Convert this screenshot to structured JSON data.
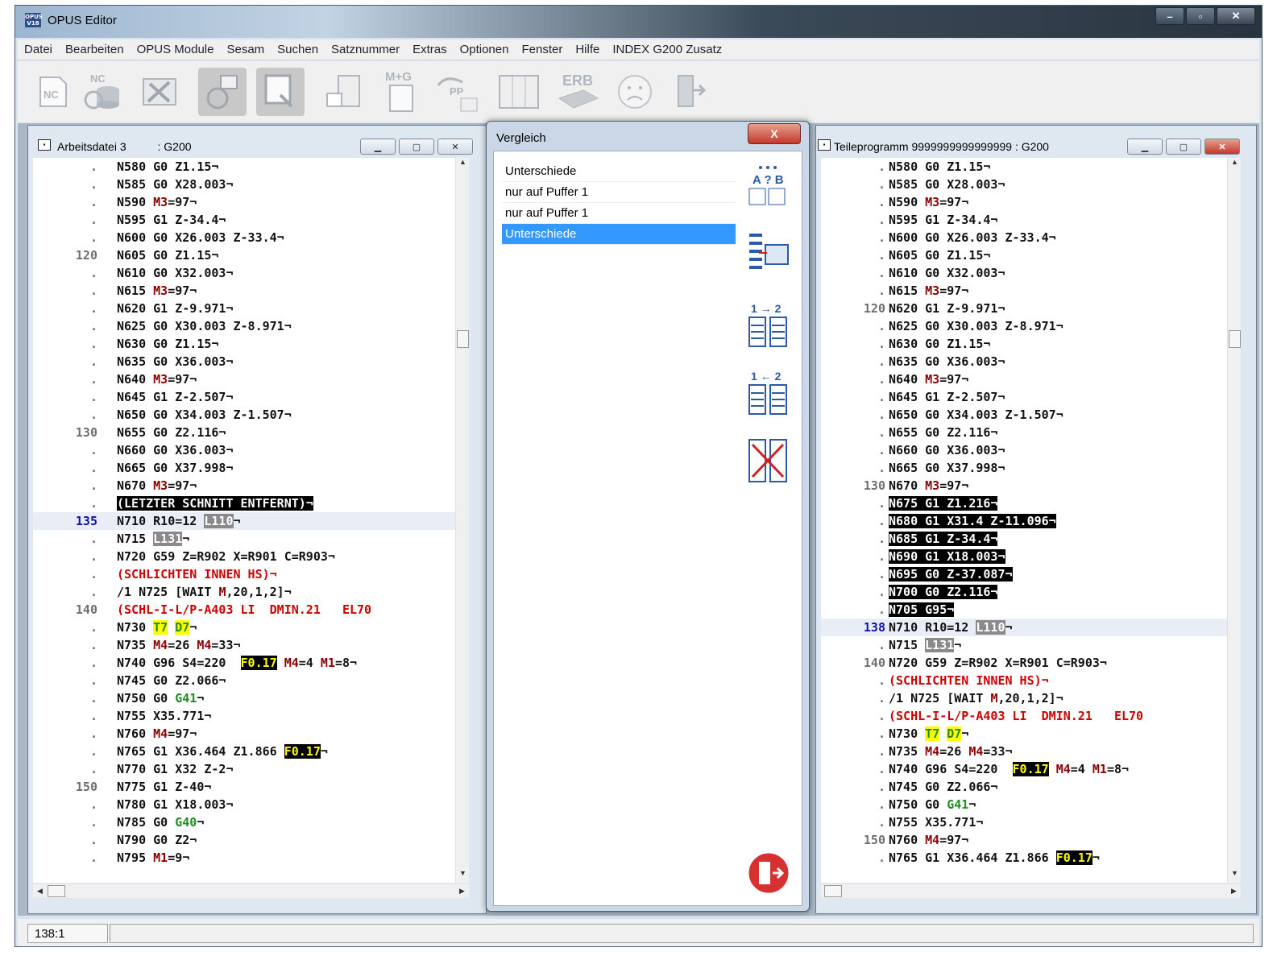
{
  "app": {
    "title": "OPUS Editor",
    "icon_label": "OPUS V18"
  },
  "window_controls": {
    "minimize": "–",
    "maximize": "▫",
    "close": "✕"
  },
  "menu": [
    "Datei",
    "Bearbeiten",
    "OPUS Module",
    "Sesam",
    "Suchen",
    "Satznummer",
    "Extras",
    "Optionen",
    "Fenster",
    "Hilfe",
    "INDEX G200 Zusatz"
  ],
  "toolbar": {
    "nc_label": "NC",
    "nc_db_label": "NC",
    "mg_label": "M+G",
    "erb_label": "ERB",
    "pp_label": "PP"
  },
  "left_window": {
    "title": "Arbeitsdatei 3          : G200",
    "lines": [
      {
        "n": ".",
        "t": "N580 G0 Z1.15¬"
      },
      {
        "n": ".",
        "t": "N585 G0 X28.003¬"
      },
      {
        "n": ".",
        "t": "N590 M3=97¬"
      },
      {
        "n": ".",
        "t": "N595 G1 Z-34.4¬"
      },
      {
        "n": ".",
        "t": "N600 G0 X26.003 Z-33.4¬"
      },
      {
        "n": "120",
        "t": "N605 G0 Z1.15¬"
      },
      {
        "n": ".",
        "t": "N610 G0 X32.003¬"
      },
      {
        "n": ".",
        "t": "N615 M3=97¬"
      },
      {
        "n": ".",
        "t": "N620 G1 Z-9.971¬"
      },
      {
        "n": ".",
        "t": "N625 G0 X30.003 Z-8.971¬"
      },
      {
        "n": ".",
        "t": "N630 G0 Z1.15¬"
      },
      {
        "n": ".",
        "t": "N635 G0 X36.003¬"
      },
      {
        "n": ".",
        "t": "N640 M3=97¬"
      },
      {
        "n": ".",
        "t": "N645 G1 Z-2.507¬"
      },
      {
        "n": ".",
        "t": "N650 G0 X34.003 Z-1.507¬"
      },
      {
        "n": "130",
        "t": "N655 G0 Z2.116¬"
      },
      {
        "n": ".",
        "t": "N660 G0 X36.003¬"
      },
      {
        "n": ".",
        "t": "N665 G0 X37.998¬"
      },
      {
        "n": ".",
        "t": "N670 M3=97¬"
      },
      {
        "n": ".",
        "t": "(LETZTER SCHNITT ENTFERNT)¬"
      },
      {
        "n": "135",
        "t": "N710 R10=12 L110¬"
      },
      {
        "n": ".",
        "t": "N715 L131¬"
      },
      {
        "n": ".",
        "t": "N720 G59 Z=R902 X=R901 C=R903¬"
      },
      {
        "n": ".",
        "t": "(SCHLICHTEN INNEN HS)¬"
      },
      {
        "n": ".",
        "t": "/1 N725 [WAIT M,20,1,2]¬"
      },
      {
        "n": "140",
        "t": "(SCHL-I-L/P-A403 LI  DMIN.21   EL70"
      },
      {
        "n": ".",
        "t": "N730 T7 D7¬"
      },
      {
        "n": ".",
        "t": "N735 M4=26 M4=33¬"
      },
      {
        "n": ".",
        "t": "N740 G96 S4=220  F0.17 M4=4 M1=8¬"
      },
      {
        "n": ".",
        "t": "N745 G0 Z2.066¬"
      },
      {
        "n": ".",
        "t": "N750 G0 G41¬"
      },
      {
        "n": ".",
        "t": "N755 X35.771¬"
      },
      {
        "n": ".",
        "t": "N760 M4=97¬"
      },
      {
        "n": ".",
        "t": "N765 G1 X36.464 Z1.866 F0.17¬"
      },
      {
        "n": ".",
        "t": "N770 G1 X32 Z-2¬"
      },
      {
        "n": "150",
        "t": "N775 G1 Z-40¬"
      },
      {
        "n": ".",
        "t": "N780 G1 X18.003¬"
      },
      {
        "n": ".",
        "t": "N785 G0 G40¬"
      },
      {
        "n": ".",
        "t": "N790 G0 Z2¬"
      },
      {
        "n": ".",
        "t": "N795 M1=9¬"
      }
    ]
  },
  "right_window": {
    "title": "Teileprogramm 9999999999999999 : G200",
    "lines": [
      {
        "n": ".",
        "t": "N580 G0 Z1.15¬"
      },
      {
        "n": ".",
        "t": "N585 G0 X28.003¬"
      },
      {
        "n": ".",
        "t": "N590 M3=97¬"
      },
      {
        "n": ".",
        "t": "N595 G1 Z-34.4¬"
      },
      {
        "n": ".",
        "t": "N600 G0 X26.003 Z-33.4¬"
      },
      {
        "n": ".",
        "t": "N605 G0 Z1.15¬"
      },
      {
        "n": ".",
        "t": "N610 G0 X32.003¬"
      },
      {
        "n": ".",
        "t": "N615 M3=97¬"
      },
      {
        "n": "120",
        "t": "N620 G1 Z-9.971¬"
      },
      {
        "n": ".",
        "t": "N625 G0 X30.003 Z-8.971¬"
      },
      {
        "n": ".",
        "t": "N630 G0 Z1.15¬"
      },
      {
        "n": ".",
        "t": "N635 G0 X36.003¬"
      },
      {
        "n": ".",
        "t": "N640 M3=97¬"
      },
      {
        "n": ".",
        "t": "N645 G1 Z-2.507¬"
      },
      {
        "n": ".",
        "t": "N650 G0 X34.003 Z-1.507¬"
      },
      {
        "n": ".",
        "t": "N655 G0 Z2.116¬"
      },
      {
        "n": ".",
        "t": "N660 G0 X36.003¬"
      },
      {
        "n": ".",
        "t": "N665 G0 X37.998¬"
      },
      {
        "n": "130",
        "t": "N670 M3=97¬"
      },
      {
        "n": ".",
        "t": "N675 G1 Z1.216¬"
      },
      {
        "n": ".",
        "t": "N680 G1 X31.4 Z-11.096¬"
      },
      {
        "n": ".",
        "t": "N685 G1 Z-34.4¬"
      },
      {
        "n": ".",
        "t": "N690 G1 X18.003¬"
      },
      {
        "n": ".",
        "t": "N695 G0 Z-37.087¬"
      },
      {
        "n": ".",
        "t": "N700 G0 Z2.116¬"
      },
      {
        "n": ".",
        "t": "N705 G95¬"
      },
      {
        "n": "138",
        "t": "N710 R10=12 L110¬"
      },
      {
        "n": ".",
        "t": "N715 L131¬"
      },
      {
        "n": "140",
        "t": "N720 G59 Z=R902 X=R901 C=R903¬"
      },
      {
        "n": ".",
        "t": "(SCHLICHTEN INNEN HS)¬"
      },
      {
        "n": ".",
        "t": "/1 N725 [WAIT M,20,1,2]¬"
      },
      {
        "n": ".",
        "t": "(SCHL-I-L/P-A403 LI  DMIN.21   EL70"
      },
      {
        "n": ".",
        "t": "N730 T7 D7¬"
      },
      {
        "n": ".",
        "t": "N735 M4=26 M4=33¬"
      },
      {
        "n": ".",
        "t": "N740 G96 S4=220  F0.17 M4=4 M1=8¬"
      },
      {
        "n": ".",
        "t": "N745 G0 Z2.066¬"
      },
      {
        "n": ".",
        "t": "N750 G0 G41¬"
      },
      {
        "n": ".",
        "t": "N755 X35.771¬"
      },
      {
        "n": "150",
        "t": "N760 M4=97¬"
      },
      {
        "n": ".",
        "t": "N765 G1 X36.464 Z1.866 F0.17¬"
      }
    ]
  },
  "compare_dialog": {
    "title": "Vergleich",
    "close": "X",
    "items": [
      "Unterschiede",
      "nur auf Puffer 1",
      "nur auf Puffer 1",
      "Unterschiede"
    ],
    "selected_index": 3,
    "tools": {
      "compare_label": "A ? B",
      "copy_1_to_2": "1 → 2",
      "copy_2_to_1": "1 ← 2"
    }
  },
  "status": {
    "position": "138:1"
  },
  "colors": {
    "selection": "#3399ff",
    "code_red": "#cc0000",
    "code_darkred": "#8b0000",
    "code_green": "#228b22",
    "highlight_yellow": "#ffff00"
  }
}
